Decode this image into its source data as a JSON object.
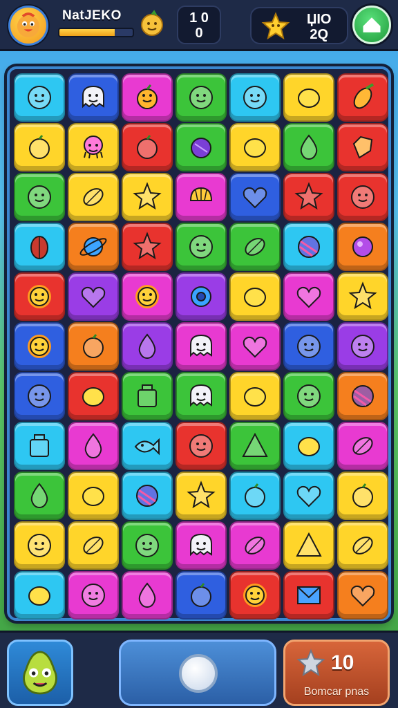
{
  "header": {
    "player_name": "NatJEKO",
    "xp_progress_percent": 75,
    "moves": {
      "line1": "1 0",
      "line2": "0"
    },
    "score": {
      "line1": "ЏIO",
      "line2": "2Q"
    }
  },
  "colors": {
    "cyan": "#2ec7f2",
    "blue": "#2f5fe0",
    "magenta": "#e83ad1",
    "green": "#3cc43a",
    "yellow": "#ffd52a",
    "red": "#e8332e",
    "orange": "#f57f1e",
    "purple": "#9a3de6"
  },
  "board": {
    "rows": [
      [
        {
          "color": "cyan",
          "icon": "face-icon"
        },
        {
          "color": "blue",
          "icon": "ghost-icon"
        },
        {
          "color": "magenta",
          "icon": "fruit-icon"
        },
        {
          "color": "green",
          "icon": "face-icon"
        },
        {
          "color": "cyan",
          "icon": "face-icon"
        },
        {
          "color": "yellow",
          "icon": "lemon-icon"
        },
        {
          "color": "red",
          "icon": "corn-icon"
        }
      ],
      [
        {
          "color": "yellow",
          "icon": "berry-icon"
        },
        {
          "color": "yellow",
          "icon": "octopus-icon"
        },
        {
          "color": "red",
          "icon": "berry-icon"
        },
        {
          "color": "green",
          "icon": "plum-icon"
        },
        {
          "color": "yellow",
          "icon": "lemon-icon"
        },
        {
          "color": "green",
          "icon": "drop-icon"
        },
        {
          "color": "red",
          "icon": "diamond-icon"
        }
      ],
      [
        {
          "color": "green",
          "icon": "face-icon"
        },
        {
          "color": "yellow",
          "icon": "leaf-icon"
        },
        {
          "color": "yellow",
          "icon": "star-icon"
        },
        {
          "color": "magenta",
          "icon": "shell-icon"
        },
        {
          "color": "blue",
          "icon": "heart-icon"
        },
        {
          "color": "red",
          "icon": "star-icon"
        },
        {
          "color": "red",
          "icon": "face-icon"
        }
      ],
      [
        {
          "color": "cyan",
          "icon": "nut-icon"
        },
        {
          "color": "orange",
          "icon": "planet-icon"
        },
        {
          "color": "red",
          "icon": "star-icon"
        },
        {
          "color": "green",
          "icon": "face-icon"
        },
        {
          "color": "green",
          "icon": "leaf-icon"
        },
        {
          "color": "cyan",
          "icon": "ball-icon"
        },
        {
          "color": "orange",
          "icon": "candy-icon"
        }
      ],
      [
        {
          "color": "red",
          "icon": "sun-icon"
        },
        {
          "color": "purple",
          "icon": "heart-icon"
        },
        {
          "color": "magenta",
          "icon": "sun-icon"
        },
        {
          "color": "purple",
          "icon": "ring-icon"
        },
        {
          "color": "yellow",
          "icon": "lemon-icon"
        },
        {
          "color": "magenta",
          "icon": "heart-icon"
        },
        {
          "color": "yellow",
          "icon": "star-icon"
        }
      ],
      [
        {
          "color": "blue",
          "icon": "sun-icon"
        },
        {
          "color": "orange",
          "icon": "berry-icon"
        },
        {
          "color": "purple",
          "icon": "drop-icon"
        },
        {
          "color": "magenta",
          "icon": "ghost-icon"
        },
        {
          "color": "magenta",
          "icon": "heart-icon"
        },
        {
          "color": "blue",
          "icon": "face-icon"
        },
        {
          "color": "purple",
          "icon": "face-icon"
        }
      ],
      [
        {
          "color": "blue",
          "icon": "face-icon"
        },
        {
          "color": "red",
          "icon": "lemon-icon"
        },
        {
          "color": "green",
          "icon": "jar-icon"
        },
        {
          "color": "green",
          "icon": "ghost-icon"
        },
        {
          "color": "yellow",
          "icon": "lemon-icon"
        },
        {
          "color": "green",
          "icon": "face-icon"
        },
        {
          "color": "orange",
          "icon": "ball-icon"
        }
      ],
      [
        {
          "color": "cyan",
          "icon": "jar-icon"
        },
        {
          "color": "magenta",
          "icon": "drop-icon"
        },
        {
          "color": "cyan",
          "icon": "fish-icon"
        },
        {
          "color": "red",
          "icon": "face-icon"
        },
        {
          "color": "green",
          "icon": "triangle-icon"
        },
        {
          "color": "cyan",
          "icon": "lemon-icon"
        },
        {
          "color": "magenta",
          "icon": "leaf-icon"
        }
      ],
      [
        {
          "color": "green",
          "icon": "drop-icon"
        },
        {
          "color": "yellow",
          "icon": "lemon-icon"
        },
        {
          "color": "cyan",
          "icon": "ball-icon"
        },
        {
          "color": "yellow",
          "icon": "star-icon"
        },
        {
          "color": "cyan",
          "icon": "berry-icon"
        },
        {
          "color": "cyan",
          "icon": "heart-icon"
        },
        {
          "color": "yellow",
          "icon": "berry-icon"
        }
      ],
      [
        {
          "color": "yellow",
          "icon": "face-icon"
        },
        {
          "color": "yellow",
          "icon": "leaf-icon"
        },
        {
          "color": "green",
          "icon": "face-icon"
        },
        {
          "color": "magenta",
          "icon": "ghost-icon"
        },
        {
          "color": "magenta",
          "icon": "leaf-icon"
        },
        {
          "color": "yellow",
          "icon": "triangle-icon"
        },
        {
          "color": "yellow",
          "icon": "leaf-icon"
        }
      ],
      [
        {
          "color": "cyan",
          "icon": "lemon-icon"
        },
        {
          "color": "magenta",
          "icon": "face-icon"
        },
        {
          "color": "magenta",
          "icon": "drop-icon"
        },
        {
          "color": "blue",
          "icon": "berry-icon"
        },
        {
          "color": "red",
          "icon": "sun-icon"
        },
        {
          "color": "red",
          "icon": "envelope-icon"
        },
        {
          "color": "orange",
          "icon": "heart-icon"
        }
      ]
    ]
  },
  "footer": {
    "booster_count": "10",
    "booster_label": "Bomcar pnas"
  }
}
